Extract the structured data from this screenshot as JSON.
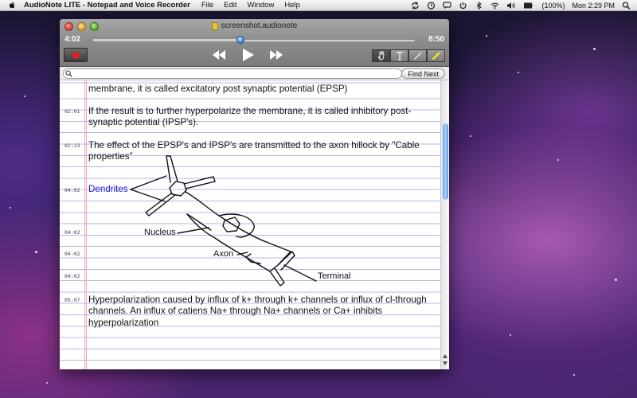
{
  "menubar": {
    "app_name": "AudioNote LITE - Notepad and Voice Recorder",
    "menus": [
      "File",
      "Edit",
      "Window",
      "Help"
    ],
    "battery": "(100%)",
    "clock": "Mon 2:29 PM",
    "icons": [
      "sync-icon",
      "clock-icon",
      "speech-bubble-icon",
      "power-icon",
      "bluetooth-icon",
      "wifi-icon",
      "volume-icon",
      "battery-icon",
      "spotlight-icon"
    ]
  },
  "window": {
    "title": "screenshot.audionote",
    "time_elapsed": "4:02",
    "time_total": "8:50",
    "playback_progress": 0.457,
    "search": {
      "value": "",
      "placeholder": "",
      "find_next_label": "Find Next"
    },
    "tools": [
      "hand-tool-icon",
      "text-tool-icon",
      "pen-tool-icon",
      "highlighter-tool-icon"
    ],
    "active_tool": "hand-tool-icon"
  },
  "notes": {
    "entries": [
      {
        "timestamp": "",
        "text": "membrane, it is called excitatory post synaptic potential (EPSP)"
      },
      {
        "timestamp": "02:01",
        "text": "If the result is to further hyperpolarize the membrane, it is called inhibitory post-synaptic potential (IPSP's)."
      },
      {
        "timestamp": "02:23",
        "text": "The effect of the EPSP's and IPSP's are transmitted to the axon hillock by \"Cable properties\""
      },
      {
        "timestamp": "04:02",
        "text": "Dendrites"
      },
      {
        "timestamp": "04:02",
        "text": "Nucleus"
      },
      {
        "timestamp": "04:02",
        "text": "Axon"
      },
      {
        "timestamp": "04:02",
        "text": "Terminal"
      },
      {
        "timestamp": "05:07",
        "text": "Hyperpolarization caused by influx of k+ through k+ channels or influx of cl-through channels. An influx of catiens Na+ through Na+ channels or Ca+ inhibits hyperpolarization"
      }
    ]
  }
}
